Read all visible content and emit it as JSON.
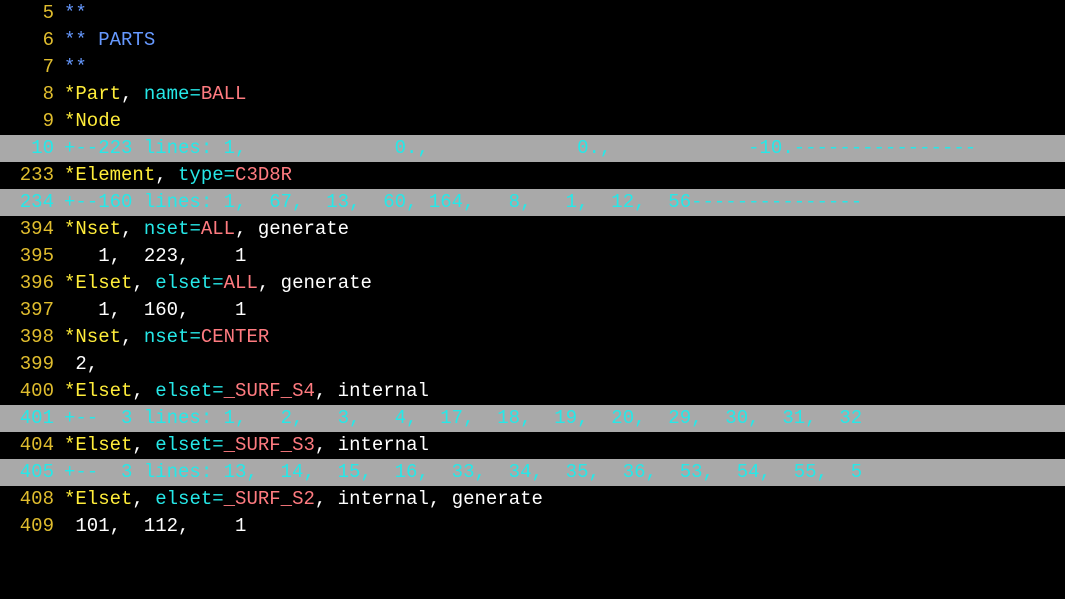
{
  "lines": [
    {
      "num": 5,
      "gutClass": "gut-normal",
      "fold": false,
      "tokens": [
        {
          "t": "**",
          "c": "c-comment"
        }
      ]
    },
    {
      "num": 6,
      "gutClass": "gut-normal",
      "fold": false,
      "tokens": [
        {
          "t": "** PARTS",
          "c": "c-comment"
        }
      ]
    },
    {
      "num": 7,
      "gutClass": "gut-normal",
      "fold": false,
      "tokens": [
        {
          "t": "**",
          "c": "c-comment"
        }
      ]
    },
    {
      "num": 8,
      "gutClass": "gut-normal",
      "fold": false,
      "tokens": [
        {
          "t": "*Part",
          "c": "c-kw"
        },
        {
          "t": ", ",
          "c": "c-plain"
        },
        {
          "t": "name",
          "c": "c-param"
        },
        {
          "t": "=",
          "c": "c-eq"
        },
        {
          "t": "BALL",
          "c": "c-val"
        }
      ]
    },
    {
      "num": 9,
      "gutClass": "gut-normal",
      "fold": false,
      "tokens": [
        {
          "t": "*Node",
          "c": "c-kw"
        }
      ]
    },
    {
      "num": 10,
      "gutClass": "gut-fold",
      "fold": true,
      "tokens": [
        {
          "t": "+--223 lines: 1,             0.,             0.,            -10.----------------",
          "c": "c-fold"
        }
      ]
    },
    {
      "num": 233,
      "gutClass": "gut-normal",
      "fold": false,
      "tokens": [
        {
          "t": "*Element",
          "c": "c-kw"
        },
        {
          "t": ", ",
          "c": "c-plain"
        },
        {
          "t": "type",
          "c": "c-param"
        },
        {
          "t": "=",
          "c": "c-eq"
        },
        {
          "t": "C3D8R",
          "c": "c-val"
        }
      ]
    },
    {
      "num": 234,
      "gutClass": "gut-fold",
      "fold": true,
      "tokens": [
        {
          "t": "+--160 lines: 1,  67,  13,  60, 164,   8,   1,  12,  56---------------",
          "c": "c-fold"
        }
      ]
    },
    {
      "num": 394,
      "gutClass": "gut-normal",
      "fold": false,
      "tokens": [
        {
          "t": "*Nset",
          "c": "c-kw"
        },
        {
          "t": ", ",
          "c": "c-plain"
        },
        {
          "t": "nset",
          "c": "c-param"
        },
        {
          "t": "=",
          "c": "c-eq"
        },
        {
          "t": "ALL",
          "c": "c-val"
        },
        {
          "t": ", generate",
          "c": "c-plain"
        }
      ]
    },
    {
      "num": 395,
      "gutClass": "gut-normal",
      "fold": false,
      "tokens": [
        {
          "t": "   1,  223,    1",
          "c": "c-plain"
        }
      ]
    },
    {
      "num": 396,
      "gutClass": "gut-normal",
      "fold": false,
      "tokens": [
        {
          "t": "*Elset",
          "c": "c-kw"
        },
        {
          "t": ", ",
          "c": "c-plain"
        },
        {
          "t": "elset",
          "c": "c-param"
        },
        {
          "t": "=",
          "c": "c-eq"
        },
        {
          "t": "ALL",
          "c": "c-val"
        },
        {
          "t": ", generate",
          "c": "c-plain"
        }
      ]
    },
    {
      "num": 397,
      "gutClass": "gut-normal",
      "fold": false,
      "tokens": [
        {
          "t": "   1,  160,    1",
          "c": "c-plain"
        }
      ]
    },
    {
      "num": 398,
      "gutClass": "gut-normal",
      "fold": false,
      "tokens": [
        {
          "t": "*Nset",
          "c": "c-kw"
        },
        {
          "t": ", ",
          "c": "c-plain"
        },
        {
          "t": "nset",
          "c": "c-param"
        },
        {
          "t": "=",
          "c": "c-eq"
        },
        {
          "t": "CENTER",
          "c": "c-val"
        }
      ]
    },
    {
      "num": 399,
      "gutClass": "gut-normal",
      "fold": false,
      "tokens": [
        {
          "t": " 2,",
          "c": "c-plain"
        }
      ]
    },
    {
      "num": 400,
      "gutClass": "gut-normal",
      "fold": false,
      "tokens": [
        {
          "t": "*Elset",
          "c": "c-kw"
        },
        {
          "t": ", ",
          "c": "c-plain"
        },
        {
          "t": "elset",
          "c": "c-param"
        },
        {
          "t": "=",
          "c": "c-eq"
        },
        {
          "t": "_SURF_S4",
          "c": "c-val"
        },
        {
          "t": ", internal",
          "c": "c-plain"
        }
      ]
    },
    {
      "num": 401,
      "gutClass": "gut-fold",
      "fold": true,
      "tokens": [
        {
          "t": "+--  3 lines: 1,   2,   3,   4,  17,  18,  19,  20,  29,  30,  31,  32",
          "c": "c-fold"
        }
      ]
    },
    {
      "num": 404,
      "gutClass": "gut-normal",
      "fold": false,
      "tokens": [
        {
          "t": "*Elset",
          "c": "c-kw"
        },
        {
          "t": ", ",
          "c": "c-plain"
        },
        {
          "t": "elset",
          "c": "c-param"
        },
        {
          "t": "=",
          "c": "c-eq"
        },
        {
          "t": "_SURF_S3",
          "c": "c-val"
        },
        {
          "t": ", internal",
          "c": "c-plain"
        }
      ]
    },
    {
      "num": 405,
      "gutClass": "gut-fold",
      "fold": true,
      "tokens": [
        {
          "t": "+--  3 lines: 13,  14,  15,  16,  33,  34,  35,  36,  53,  54,  55,  5",
          "c": "c-fold"
        }
      ]
    },
    {
      "num": 408,
      "gutClass": "gut-normal",
      "fold": false,
      "tokens": [
        {
          "t": "*Elset",
          "c": "c-kw"
        },
        {
          "t": ", ",
          "c": "c-plain"
        },
        {
          "t": "elset",
          "c": "c-param"
        },
        {
          "t": "=",
          "c": "c-eq"
        },
        {
          "t": "_SURF_S2",
          "c": "c-val"
        },
        {
          "t": ", internal, generate",
          "c": "c-plain"
        }
      ]
    },
    {
      "num": 409,
      "gutClass": "gut-normal",
      "fold": false,
      "tokens": [
        {
          "t": " 101,  112,    1",
          "c": "c-plain"
        }
      ]
    }
  ]
}
